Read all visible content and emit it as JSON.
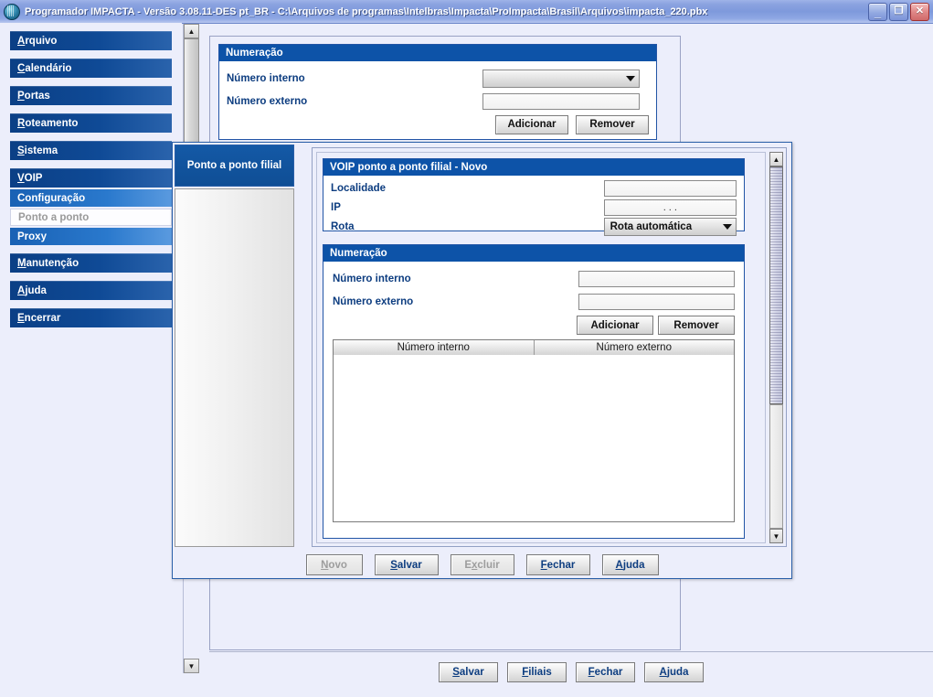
{
  "window": {
    "title": "Programador IMPACTA - Versão  3.08.11-DES pt_BR - C:\\Arquivos de programas\\Intelbras\\Impacta\\ProImpacta\\Brasil\\Arquivos\\impacta_220.pbx",
    "icon": "app-globe-icon",
    "buttons": {
      "minimize": "_",
      "restore": "❐",
      "close": "✕"
    },
    "accent_color": "#0d53a8",
    "titlebar_color": "#8ba3e0"
  },
  "sidebar": {
    "items": [
      {
        "label": "Arquivo",
        "mnemonic": "A",
        "type": "top",
        "state": "normal"
      },
      {
        "label": "Calendário",
        "mnemonic": "C",
        "type": "top",
        "state": "normal"
      },
      {
        "label": "Portas",
        "mnemonic": "P",
        "type": "top",
        "state": "normal"
      },
      {
        "label": "Roteamento",
        "mnemonic": "R",
        "type": "top",
        "state": "normal"
      },
      {
        "label": "Sistema",
        "mnemonic": "S",
        "type": "top",
        "state": "normal"
      },
      {
        "label": "VOIP",
        "mnemonic": "V",
        "type": "top",
        "state": "expanded"
      },
      {
        "label": "Configuração",
        "mnemonic": "",
        "type": "sub",
        "state": "normal"
      },
      {
        "label": "Ponto a ponto",
        "mnemonic": "",
        "type": "sub",
        "state": "selected"
      },
      {
        "label": "Proxy",
        "mnemonic": "",
        "type": "sub",
        "state": "normal"
      },
      {
        "label": "Manutenção",
        "mnemonic": "M",
        "type": "top",
        "state": "normal"
      },
      {
        "label": "Ajuda",
        "mnemonic": "A",
        "type": "top",
        "state": "normal"
      },
      {
        "label": "Encerrar",
        "mnemonic": "E",
        "type": "top",
        "state": "normal"
      }
    ]
  },
  "background_panel": {
    "numeracao": {
      "title": "Numeração",
      "numero_interno_label": "Número interno",
      "numero_interno_value": "",
      "numero_externo_label": "Número externo",
      "numero_externo_value": "",
      "add_button": "Adicionar",
      "remove_button": "Remover"
    }
  },
  "dialog": {
    "tab_label": "Ponto a ponto filial",
    "header": "VOIP ponto a ponto filial - Novo",
    "fields": {
      "localidade_label": "Localidade",
      "localidade_value": "",
      "ip_label": "IP",
      "ip_value": ".     .     .",
      "rota_label": "Rota",
      "rota_value": "Rota automática"
    },
    "numeracao": {
      "title": "Numeração",
      "numero_interno_label": "Número interno",
      "numero_interno_value": "",
      "numero_externo_label": "Número externo",
      "numero_externo_value": "",
      "add_button": "Adicionar",
      "remove_button": "Remover",
      "table": {
        "columns": [
          "Número interno",
          "Número externo"
        ],
        "rows": []
      }
    },
    "footer_buttons": [
      {
        "label": "Novo",
        "mnemonic": "N",
        "enabled": false
      },
      {
        "label": "Salvar",
        "mnemonic": "S",
        "enabled": true
      },
      {
        "label": "Excluir",
        "mnemonic": "x",
        "enabled": false
      },
      {
        "label": "Fechar",
        "mnemonic": "F",
        "enabled": true
      },
      {
        "label": "Ajuda",
        "mnemonic": "A",
        "enabled": true
      }
    ]
  },
  "main_footer_buttons": [
    {
      "label": "Salvar",
      "mnemonic": "S"
    },
    {
      "label": "Filiais",
      "mnemonic": "F"
    },
    {
      "label": "Fechar",
      "mnemonic": "F"
    },
    {
      "label": "Ajuda",
      "mnemonic": "A"
    }
  ],
  "scrollbars": {
    "left_arrow_up": "▲",
    "left_arrow_down": "▼",
    "dialog_arrow_up": "▲",
    "dialog_arrow_down": "▼"
  }
}
